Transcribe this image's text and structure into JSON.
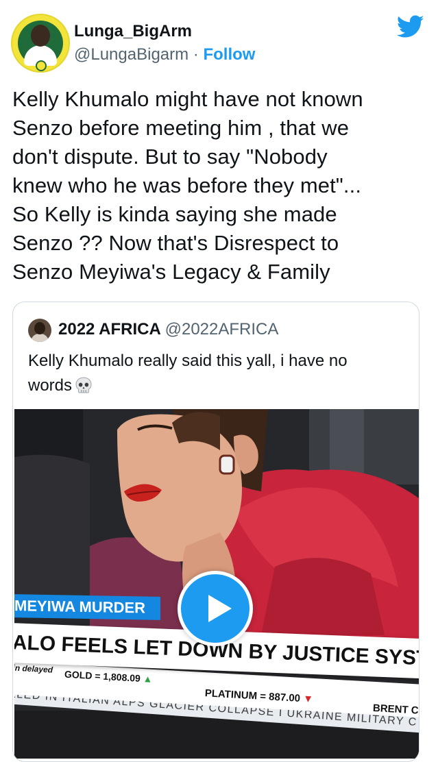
{
  "author": {
    "name": "Lunga_BigArm",
    "handle": "@LungaBigarm",
    "separator": " · ",
    "follow_label": "Follow"
  },
  "tweet": {
    "lines": [
      "Kelly Khumalo might have not known",
      "Senzo before meeting him , that we",
      "don't dispute. But to say \"Nobody",
      "knew who he was before they met\"...",
      "So Kelly is kinda saying she made",
      "Senzo ?? Now that's Disrespect to",
      "Senzo Meyiwa's Legacy & Family"
    ]
  },
  "quoted": {
    "name": "2022 AFRICA",
    "handle": "@2022AFRICA",
    "lines": [
      "Kelly Khumalo really said this yall, i have no",
      "words"
    ],
    "emoji_icon": "skull-icon"
  },
  "video": {
    "banner_top": "MEYIWA MURDER",
    "headline": "ALO FEELS LET DOWN BY JUSTICE SYSTE",
    "delayed_label": "in delayed",
    "gold_label": "GOLD = 1,808.09",
    "platinum_label": "PLATINUM = 887.00",
    "brent_label": "BRENT C",
    "ticker_text": "ILLED IN ITALIAN ALPS GLACIER COLLAPSE  I  UKRAINE MILITARY C"
  },
  "colors": {
    "twitter_blue": "#1d9bf0",
    "banner_blue": "#1487e0",
    "up_green": "#2ea043",
    "down_red": "#d62828"
  }
}
